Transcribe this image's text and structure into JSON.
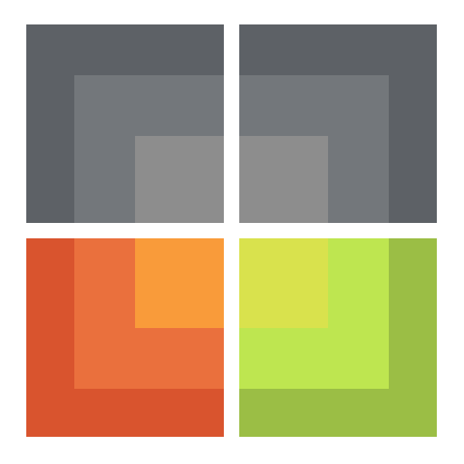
{
  "logo": {
    "quadrants": {
      "top_left": {
        "colors": [
          "#5d6166",
          "#73777b",
          "#8d8d8d"
        ]
      },
      "top_right": {
        "colors": [
          "#5d6166",
          "#73777b",
          "#8d8d8d"
        ]
      },
      "bottom_left": {
        "colors": [
          "#d9542e",
          "#ea703d",
          "#f99b3a"
        ]
      },
      "bottom_right": {
        "colors": [
          "#9bbe45",
          "#bee650",
          "#d9e24d"
        ]
      }
    }
  }
}
